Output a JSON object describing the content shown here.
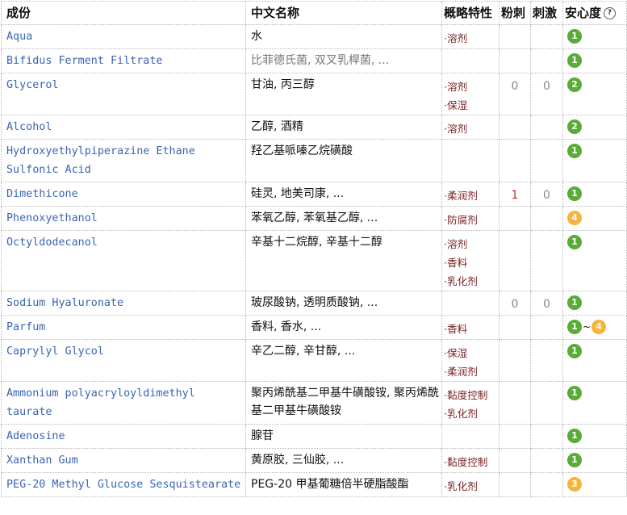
{
  "headers": {
    "ingredient": "成份",
    "chinese_name": "中文名称",
    "properties": "概略特性",
    "acne": "粉刺",
    "irritation": "刺激",
    "safety": "安心度",
    "help_icon": "?"
  },
  "rows": [
    {
      "ingredient": "Aqua",
      "cn": "水",
      "props": [
        "溶剂"
      ],
      "acne": "",
      "irritation": "",
      "safety": [
        {
          "value": "1",
          "color": "green"
        }
      ]
    },
    {
      "ingredient": "Bifidus Ferment Filtrate",
      "cn": "比菲德氏菌, 双叉乳桿菌, ...",
      "cn_gray": true,
      "props": [],
      "acne": "",
      "irritation": "",
      "safety": [
        {
          "value": "1",
          "color": "green"
        }
      ]
    },
    {
      "ingredient": "Glycerol",
      "cn": "甘油, 丙三醇",
      "props": [
        "溶剂",
        "保湿"
      ],
      "acne": "0",
      "irritation": "0",
      "safety": [
        {
          "value": "2",
          "color": "green"
        }
      ]
    },
    {
      "ingredient": "Alcohol",
      "cn": "乙醇, 酒精",
      "props": [
        "溶剂"
      ],
      "acne": "",
      "irritation": "",
      "safety": [
        {
          "value": "2",
          "color": "green"
        }
      ]
    },
    {
      "ingredient": "Hydroxyethylpiperazine Ethane Sulfonic Acid",
      "cn": "羟乙基哌嗪乙烷磺酸",
      "props": [],
      "acne": "",
      "irritation": "",
      "safety": [
        {
          "value": "1",
          "color": "green"
        }
      ]
    },
    {
      "ingredient": "Dimethicone",
      "cn": "硅灵, 地美司康, ...",
      "props": [
        "柔润剂"
      ],
      "acne": "1",
      "acne_red": true,
      "irritation": "0",
      "safety": [
        {
          "value": "1",
          "color": "green"
        }
      ]
    },
    {
      "ingredient": "Phenoxyethanol",
      "cn": "苯氧乙醇, 苯氧基乙醇, ...",
      "props": [
        "防腐剂"
      ],
      "acne": "",
      "irritation": "",
      "safety": [
        {
          "value": "4",
          "color": "orange"
        }
      ]
    },
    {
      "ingredient": "Octyldodecanol",
      "cn": "辛基十二烷醇, 辛基十二醇",
      "props": [
        "溶剂",
        "香料",
        "乳化剂"
      ],
      "acne": "",
      "irritation": "",
      "safety": [
        {
          "value": "1",
          "color": "green"
        }
      ]
    },
    {
      "ingredient": "Sodium Hyaluronate",
      "cn": "玻尿酸钠, 透明质酸钠, ...",
      "props": [],
      "acne": "0",
      "irritation": "0",
      "safety": [
        {
          "value": "1",
          "color": "green"
        }
      ]
    },
    {
      "ingredient": "Parfum",
      "cn": "香料, 香水, ...",
      "props": [
        "香料"
      ],
      "acne": "",
      "irritation": "",
      "safety": [
        {
          "value": "1",
          "color": "green"
        },
        {
          "value": "4",
          "color": "orange"
        }
      ]
    },
    {
      "ingredient": "Caprylyl Glycol",
      "cn": "辛乙二醇, 辛甘醇, ...",
      "props": [
        "保湿",
        "柔润剂"
      ],
      "acne": "",
      "irritation": "",
      "safety": [
        {
          "value": "1",
          "color": "green"
        }
      ]
    },
    {
      "ingredient": "Ammonium polyacryloyldimethyl taurate",
      "cn": "聚丙烯酰基二甲基牛磺酸铵, 聚丙烯酰基二甲基牛磺酸铵",
      "props": [
        "黏度控制",
        "乳化剂"
      ],
      "acne": "",
      "irritation": "",
      "safety": [
        {
          "value": "1",
          "color": "green"
        }
      ]
    },
    {
      "ingredient": "Adenosine",
      "cn": "腺苷",
      "props": [],
      "acne": "",
      "irritation": "",
      "safety": [
        {
          "value": "1",
          "color": "green"
        }
      ]
    },
    {
      "ingredient": "Xanthan Gum",
      "cn": "黄原胶, 三仙胶, ...",
      "props": [
        "黏度控制"
      ],
      "acne": "",
      "irritation": "",
      "safety": [
        {
          "value": "1",
          "color": "green"
        }
      ]
    },
    {
      "ingredient": "PEG-20 Methyl Glucose Sesquistearate",
      "cn": "PEG-20 甲基葡糖倍半硬脂酸酯",
      "props": [
        "乳化剂"
      ],
      "acne": "",
      "irritation": "",
      "safety": [
        {
          "value": "3",
          "color": "orange"
        }
      ]
    }
  ],
  "safety_range_separator": "~",
  "colors": {
    "link": "#3a64b3",
    "property": "#7a2424",
    "safe_green": "#5aab37",
    "safe_orange": "#f5b43a",
    "acne_red": "#cc2222"
  }
}
